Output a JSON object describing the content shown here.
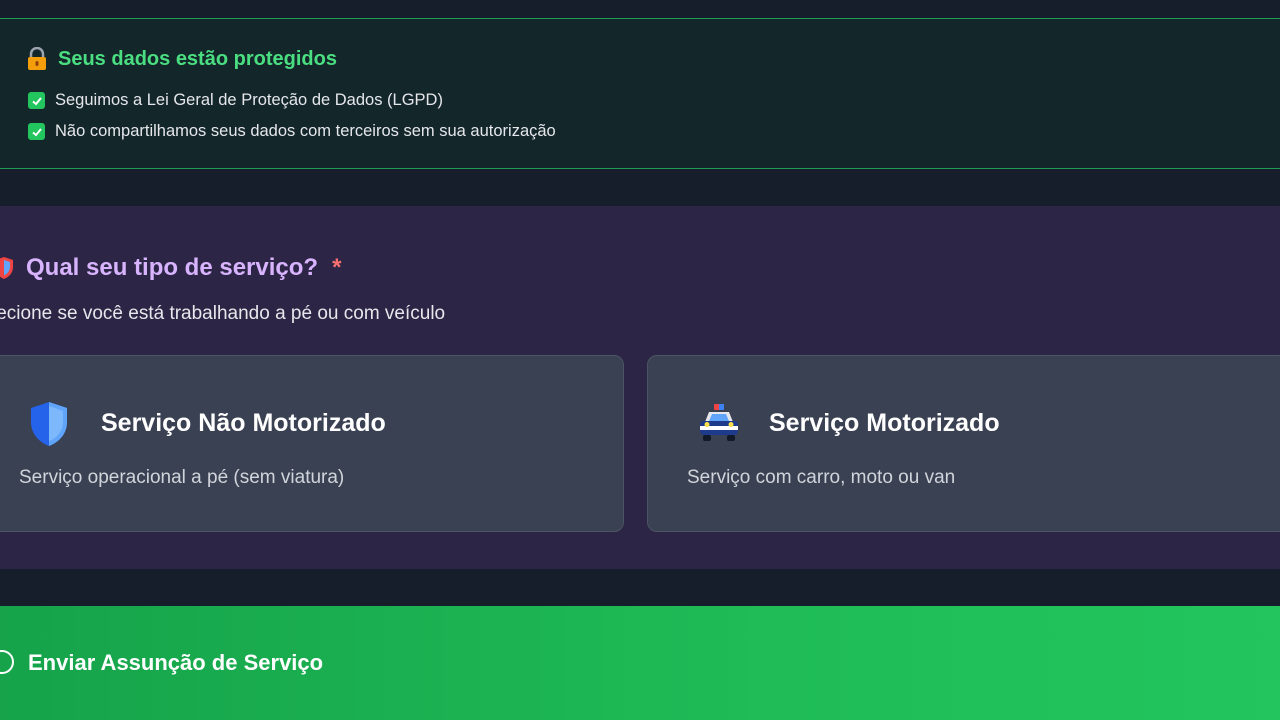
{
  "privacy": {
    "title": "Seus dados estão protegidos",
    "icon": "lock-icon",
    "items": [
      {
        "icon": "check-icon",
        "text": "Seguimos a Lei Geral de Proteção de Dados (LGPD)"
      },
      {
        "icon": "check-icon",
        "text": "Não compartilhamos seus dados com terceiros sem sua autorização"
      }
    ]
  },
  "service_type": {
    "heading": "Qual seu tipo de serviço?",
    "required_mark": "*",
    "subtitle": "lecione se você está trabalhando a pé ou com veículo",
    "options": [
      {
        "icon": "shield-icon",
        "title": "Serviço Não Motorizado",
        "description": "Serviço operacional a pé (sem viatura)"
      },
      {
        "icon": "police-car-icon",
        "title": "Serviço Motorizado",
        "description": "Serviço com carro, moto ou van"
      }
    ]
  },
  "submit": {
    "label": "Enviar Assunção de Serviço",
    "icon": "spinner-icon"
  },
  "colors": {
    "accent_green": "#22c55e",
    "heading_purple": "#d8b4fe",
    "required_red": "#f87171"
  }
}
